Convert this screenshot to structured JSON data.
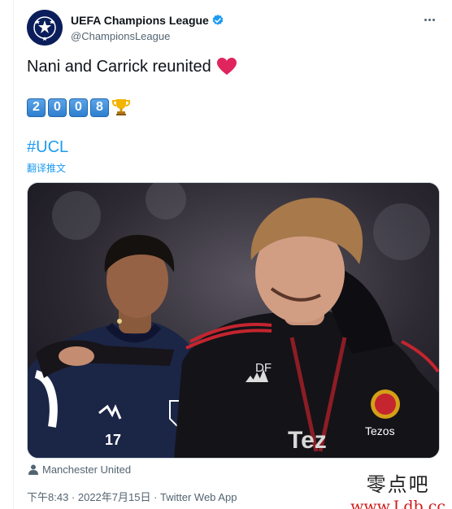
{
  "account": {
    "display_name": "UEFA Champions League",
    "handle": "@ChampionsLeague",
    "verified": true
  },
  "tweet": {
    "text": "Nani and Carrick reunited",
    "emoji_digits": [
      "2",
      "0",
      "0",
      "8"
    ],
    "hashtag": "#UCL",
    "translate_label": "翻译推文"
  },
  "media": {
    "description_jersey_number": "17",
    "initials": "DF",
    "sponsor": "Tezos",
    "sponsor_large": "Tez"
  },
  "location": "Manchester United",
  "timestamp": "下午8:43 · 2022年7月15日 · Twitter Web App",
  "watermark": {
    "chinese": "零点吧",
    "url": "www.Ldb.cc"
  },
  "colors": {
    "accent": "#1d9bf0",
    "text": "#0f1419",
    "secondary": "#536471",
    "heart": "#e0245e"
  }
}
